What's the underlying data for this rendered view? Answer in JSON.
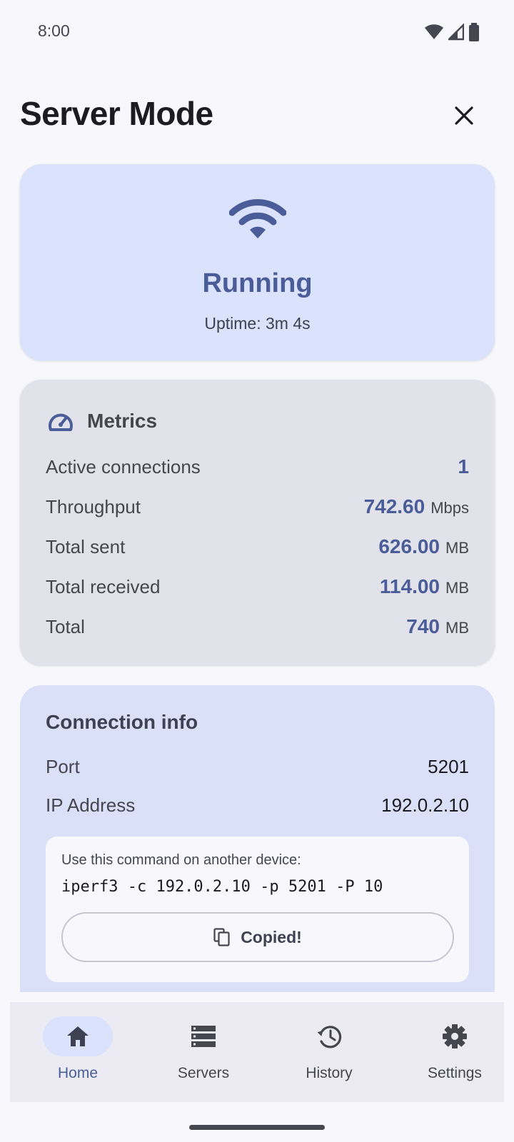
{
  "status_bar": {
    "time": "8:00"
  },
  "header": {
    "title": "Server Mode"
  },
  "server_status": {
    "state": "Running",
    "uptime": "Uptime: 3m 4s"
  },
  "metrics": {
    "title": "Metrics",
    "rows": [
      {
        "label": "Active connections",
        "value": "1",
        "unit": ""
      },
      {
        "label": "Throughput",
        "value": "742.60",
        "unit": "Mbps"
      },
      {
        "label": "Total sent",
        "value": "626.00",
        "unit": "MB"
      },
      {
        "label": "Total received",
        "value": "114.00",
        "unit": "MB"
      },
      {
        "label": "Total",
        "value": "740",
        "unit": "MB"
      }
    ]
  },
  "connection_info": {
    "title": "Connection info",
    "port_label": "Port",
    "port_value": "5201",
    "ip_label": "IP Address",
    "ip_value": "192.0.2.10",
    "command_hint": "Use this command on another device:",
    "command": "iperf3 -c 192.0.2.10 -p 5201 -P 10",
    "copy_label": "Copied!"
  },
  "nav": {
    "items": [
      {
        "label": "Home",
        "icon": "home-icon",
        "active": true
      },
      {
        "label": "Servers",
        "icon": "servers-icon",
        "active": false
      },
      {
        "label": "History",
        "icon": "history-icon",
        "active": false
      },
      {
        "label": "Settings",
        "icon": "settings-icon",
        "active": false
      }
    ]
  },
  "colors": {
    "accent": "#4a5d99",
    "status_card_bg": "#dae2fc",
    "metrics_card_bg": "#e2e2ea",
    "background": "#f8f8fc"
  }
}
